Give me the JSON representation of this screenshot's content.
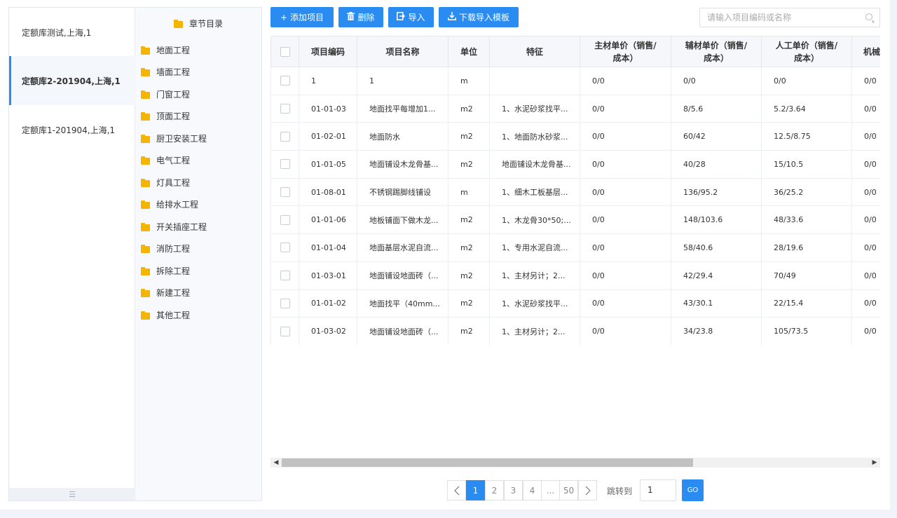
{
  "libraries": [
    {
      "label": "定额库测试,上海,1"
    },
    {
      "label": "定额库2-201904,上海,1"
    },
    {
      "label": "定额库1-201904,上海,1"
    }
  ],
  "chapter": {
    "title": "章节目录",
    "items": [
      "地面工程",
      "墙面工程",
      "门窗工程",
      "顶面工程",
      "厨卫安装工程",
      "电气工程",
      "灯具工程",
      "给排水工程",
      "开关插座工程",
      "消防工程",
      "拆除工程",
      "新建工程",
      "其他工程"
    ]
  },
  "toolbar": {
    "add_label": "添加项目",
    "delete_label": "删除",
    "import_label": "导入",
    "download_label": "下载导入模板",
    "search_placeholder": "请输入项目编码或名称"
  },
  "table": {
    "headers": {
      "code": "项目编码",
      "name": "项目名称",
      "unit": "单位",
      "feature": "特征",
      "main_l1": "主材单价（销售/",
      "main_l2": "成本）",
      "aux_l1": "辅材单价（销售/",
      "aux_l2": "成本）",
      "labor_l1": "人工单价（销售/",
      "labor_l2": "成本）",
      "mach": "机械"
    },
    "rows": [
      {
        "code": "1",
        "name": "1",
        "unit": "m",
        "feature": "",
        "main": "0/0",
        "aux": "0/0",
        "labor": "0/0",
        "mach": "0/0"
      },
      {
        "code": "01-01-03",
        "name": "地面找平每增加1...",
        "unit": "m2",
        "feature": "1、水泥砂浆找平...",
        "main": "0/0",
        "aux": "8/5.6",
        "labor": "5.2/3.64",
        "mach": "0/0"
      },
      {
        "code": "01-02-01",
        "name": "地面防水",
        "unit": "m2",
        "feature": "1、地面防水砂浆...",
        "main": "0/0",
        "aux": "60/42",
        "labor": "12.5/8.75",
        "mach": "0/0"
      },
      {
        "code": "01-01-05",
        "name": "地面铺设木龙骨基...",
        "unit": "m2",
        "feature": "地面铺设木龙骨基...",
        "main": "0/0",
        "aux": "40/28",
        "labor": "15/10.5",
        "mach": "0/0"
      },
      {
        "code": "01-08-01",
        "name": "不锈钢踢脚线铺设",
        "unit": "m",
        "feature": "1、细木工板基层...",
        "main": "0/0",
        "aux": "136/95.2",
        "labor": "36/25.2",
        "mach": "0/0"
      },
      {
        "code": "01-01-06",
        "name": "地板铺面下做木龙...",
        "unit": "m2",
        "feature": "1、木龙骨30*50;...",
        "main": "0/0",
        "aux": "148/103.6",
        "labor": "48/33.6",
        "mach": "0/0"
      },
      {
        "code": "01-01-04",
        "name": "地面基层水泥自流...",
        "unit": "m2",
        "feature": "1、专用水泥自流...",
        "main": "0/0",
        "aux": "58/40.6",
        "labor": "28/19.6",
        "mach": "0/0"
      },
      {
        "code": "01-03-01",
        "name": "地面铺设地面砖（...",
        "unit": "m2",
        "feature": "1、主材另计；2...",
        "main": "0/0",
        "aux": "42/29.4",
        "labor": "70/49",
        "mach": "0/0"
      },
      {
        "code": "01-01-02",
        "name": "地面找平（40mm...",
        "unit": "m2",
        "feature": "1、水泥砂浆找平...",
        "main": "0/0",
        "aux": "43/30.1",
        "labor": "22/15.4",
        "mach": "0/0"
      },
      {
        "code": "01-03-02",
        "name": "地面铺设地面砖（...",
        "unit": "m2",
        "feature": "1、主材另计；2...",
        "main": "0/0",
        "aux": "34/23.8",
        "labor": "105/73.5",
        "mach": "0/0"
      }
    ]
  },
  "pagination": {
    "pages": [
      "1",
      "2",
      "3",
      "4",
      "...",
      "50"
    ],
    "jump_label": "跳转到",
    "jump_value": "1",
    "go_label": "GO"
  }
}
